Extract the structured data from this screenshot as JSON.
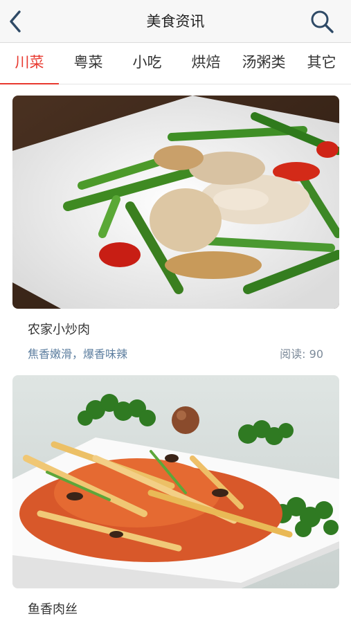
{
  "header": {
    "title": "美食资讯",
    "back_icon": "chevron-left-icon",
    "search_icon": "search-icon"
  },
  "tabs": [
    {
      "label": "川菜",
      "active": true
    },
    {
      "label": "粤菜",
      "active": false
    },
    {
      "label": "小吃",
      "active": false
    },
    {
      "label": "烘焙",
      "active": false
    },
    {
      "label": "汤粥类",
      "active": false
    },
    {
      "label": "其它",
      "active": false
    }
  ],
  "colors": {
    "accent": "#e8382e",
    "description": "#5e7fa0",
    "header_bg": "#f7f7f7"
  },
  "articles": [
    {
      "title": "农家小炒肉",
      "description": "焦香嫩滑，爆香味辣",
      "reads_label": "阅读:",
      "reads_value": "90"
    },
    {
      "title": "鱼香肉丝"
    }
  ]
}
